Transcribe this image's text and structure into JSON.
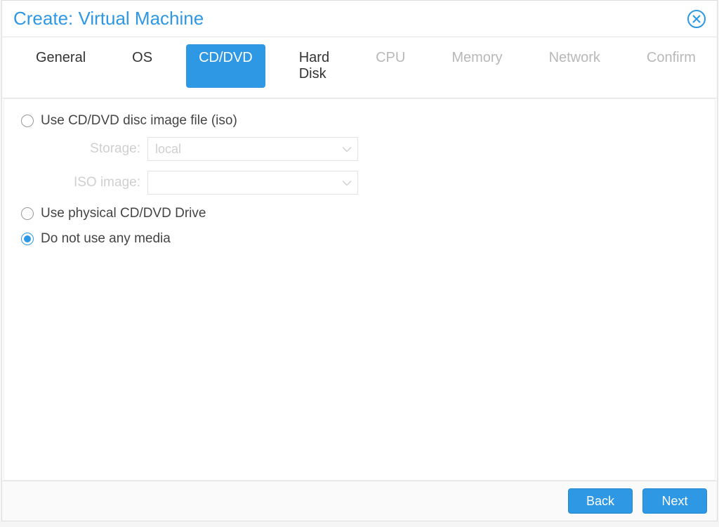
{
  "dialog": {
    "title": "Create: Virtual Machine",
    "tabs": [
      {
        "label": "General",
        "state": "enabled"
      },
      {
        "label": "OS",
        "state": "enabled"
      },
      {
        "label": "CD/DVD",
        "state": "active"
      },
      {
        "label": "Hard Disk",
        "state": "enabled"
      },
      {
        "label": "CPU",
        "state": "disabled"
      },
      {
        "label": "Memory",
        "state": "disabled"
      },
      {
        "label": "Network",
        "state": "disabled"
      },
      {
        "label": "Confirm",
        "state": "disabled"
      }
    ]
  },
  "options": {
    "use_iso": {
      "label": "Use CD/DVD disc image file (iso)",
      "selected": false,
      "fields": {
        "storage_label": "Storage:",
        "storage_value": "local",
        "iso_label": "ISO image:",
        "iso_value": ""
      }
    },
    "use_physical": {
      "label": "Use physical CD/DVD Drive",
      "selected": false
    },
    "no_media": {
      "label": "Do not use any media",
      "selected": true
    }
  },
  "footer": {
    "back": "Back",
    "next": "Next"
  }
}
